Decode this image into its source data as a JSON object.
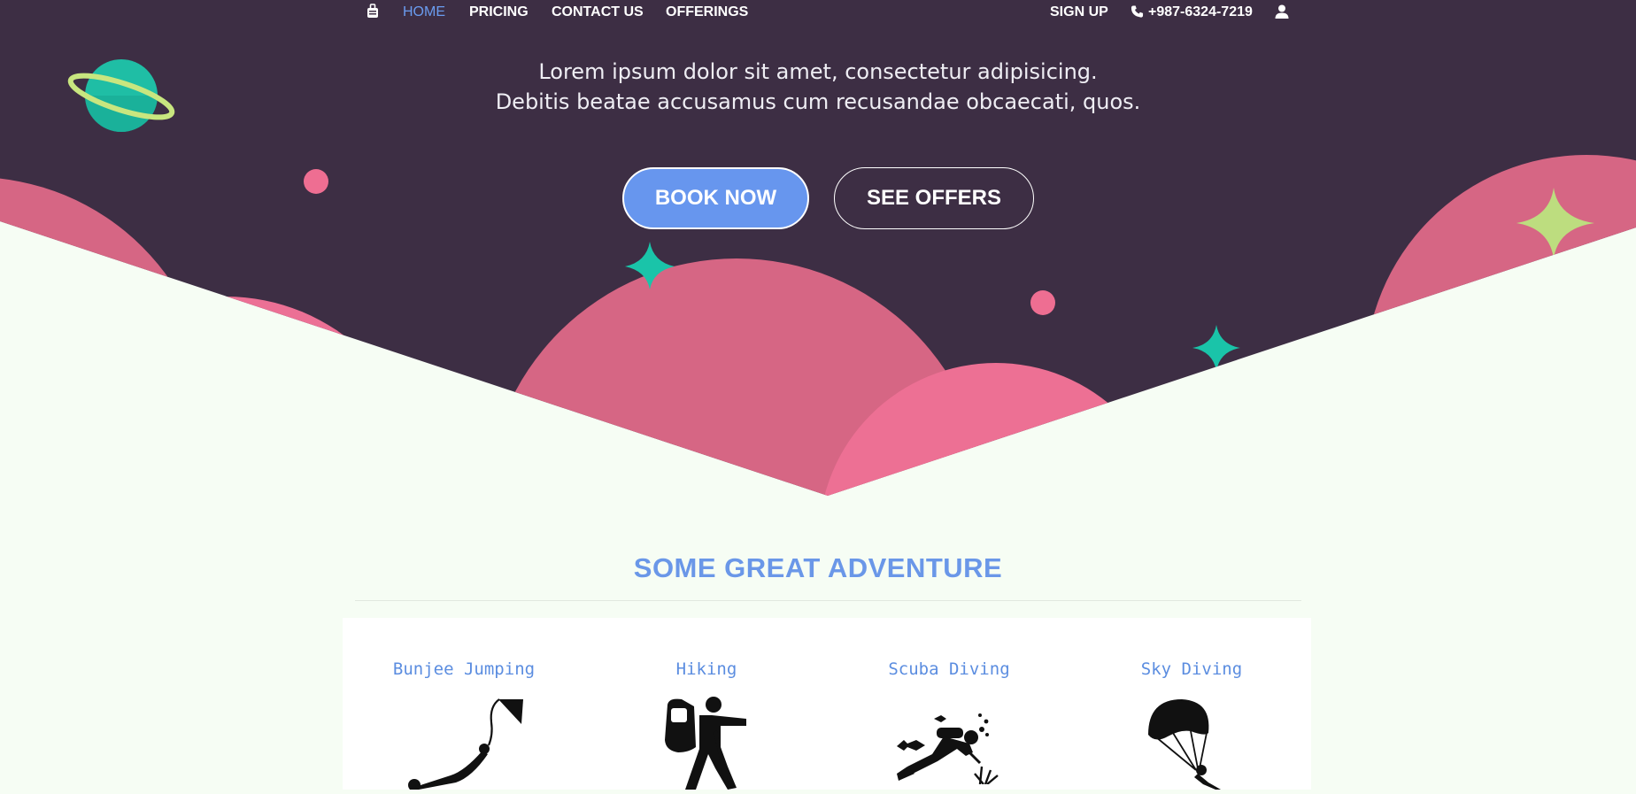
{
  "nav": {
    "items": [
      {
        "label": "HOME",
        "active": true
      },
      {
        "label": "PRICING"
      },
      {
        "label": "CONTACT US"
      },
      {
        "label": "OFFERINGS"
      }
    ],
    "signup_label": "SIGN UP",
    "phone": "+987-6324-7219",
    "luggage_icon": "luggage-icon",
    "phone_icon": "phone-icon",
    "user_icon": "user-icon"
  },
  "hero": {
    "tagline_line1": "Lorem ipsum dolor sit amet, consectetur adipisicing.",
    "tagline_line2": "Debitis beatae accusamus cum recusandae obcaecati, quos.",
    "book_label": "BOOK NOW",
    "offers_label": "SEE OFFERS"
  },
  "adventure": {
    "title": "SOME GREAT ADVENTURE",
    "activities": [
      {
        "title": "Bunjee Jumping",
        "icon": "bungee-jumping-icon"
      },
      {
        "title": "Hiking",
        "icon": "hiking-icon"
      },
      {
        "title": "Scuba Diving",
        "icon": "scuba-diving-icon"
      },
      {
        "title": "Sky Diving",
        "icon": "sky-diving-icon"
      }
    ]
  },
  "colors": {
    "dark_bg": "#3d2e44",
    "accent_blue": "#6796ee",
    "pink": "#d66684",
    "teal": "#1ac4a9",
    "lime": "#bddd7f",
    "section_bg": "#f6fdf4"
  }
}
